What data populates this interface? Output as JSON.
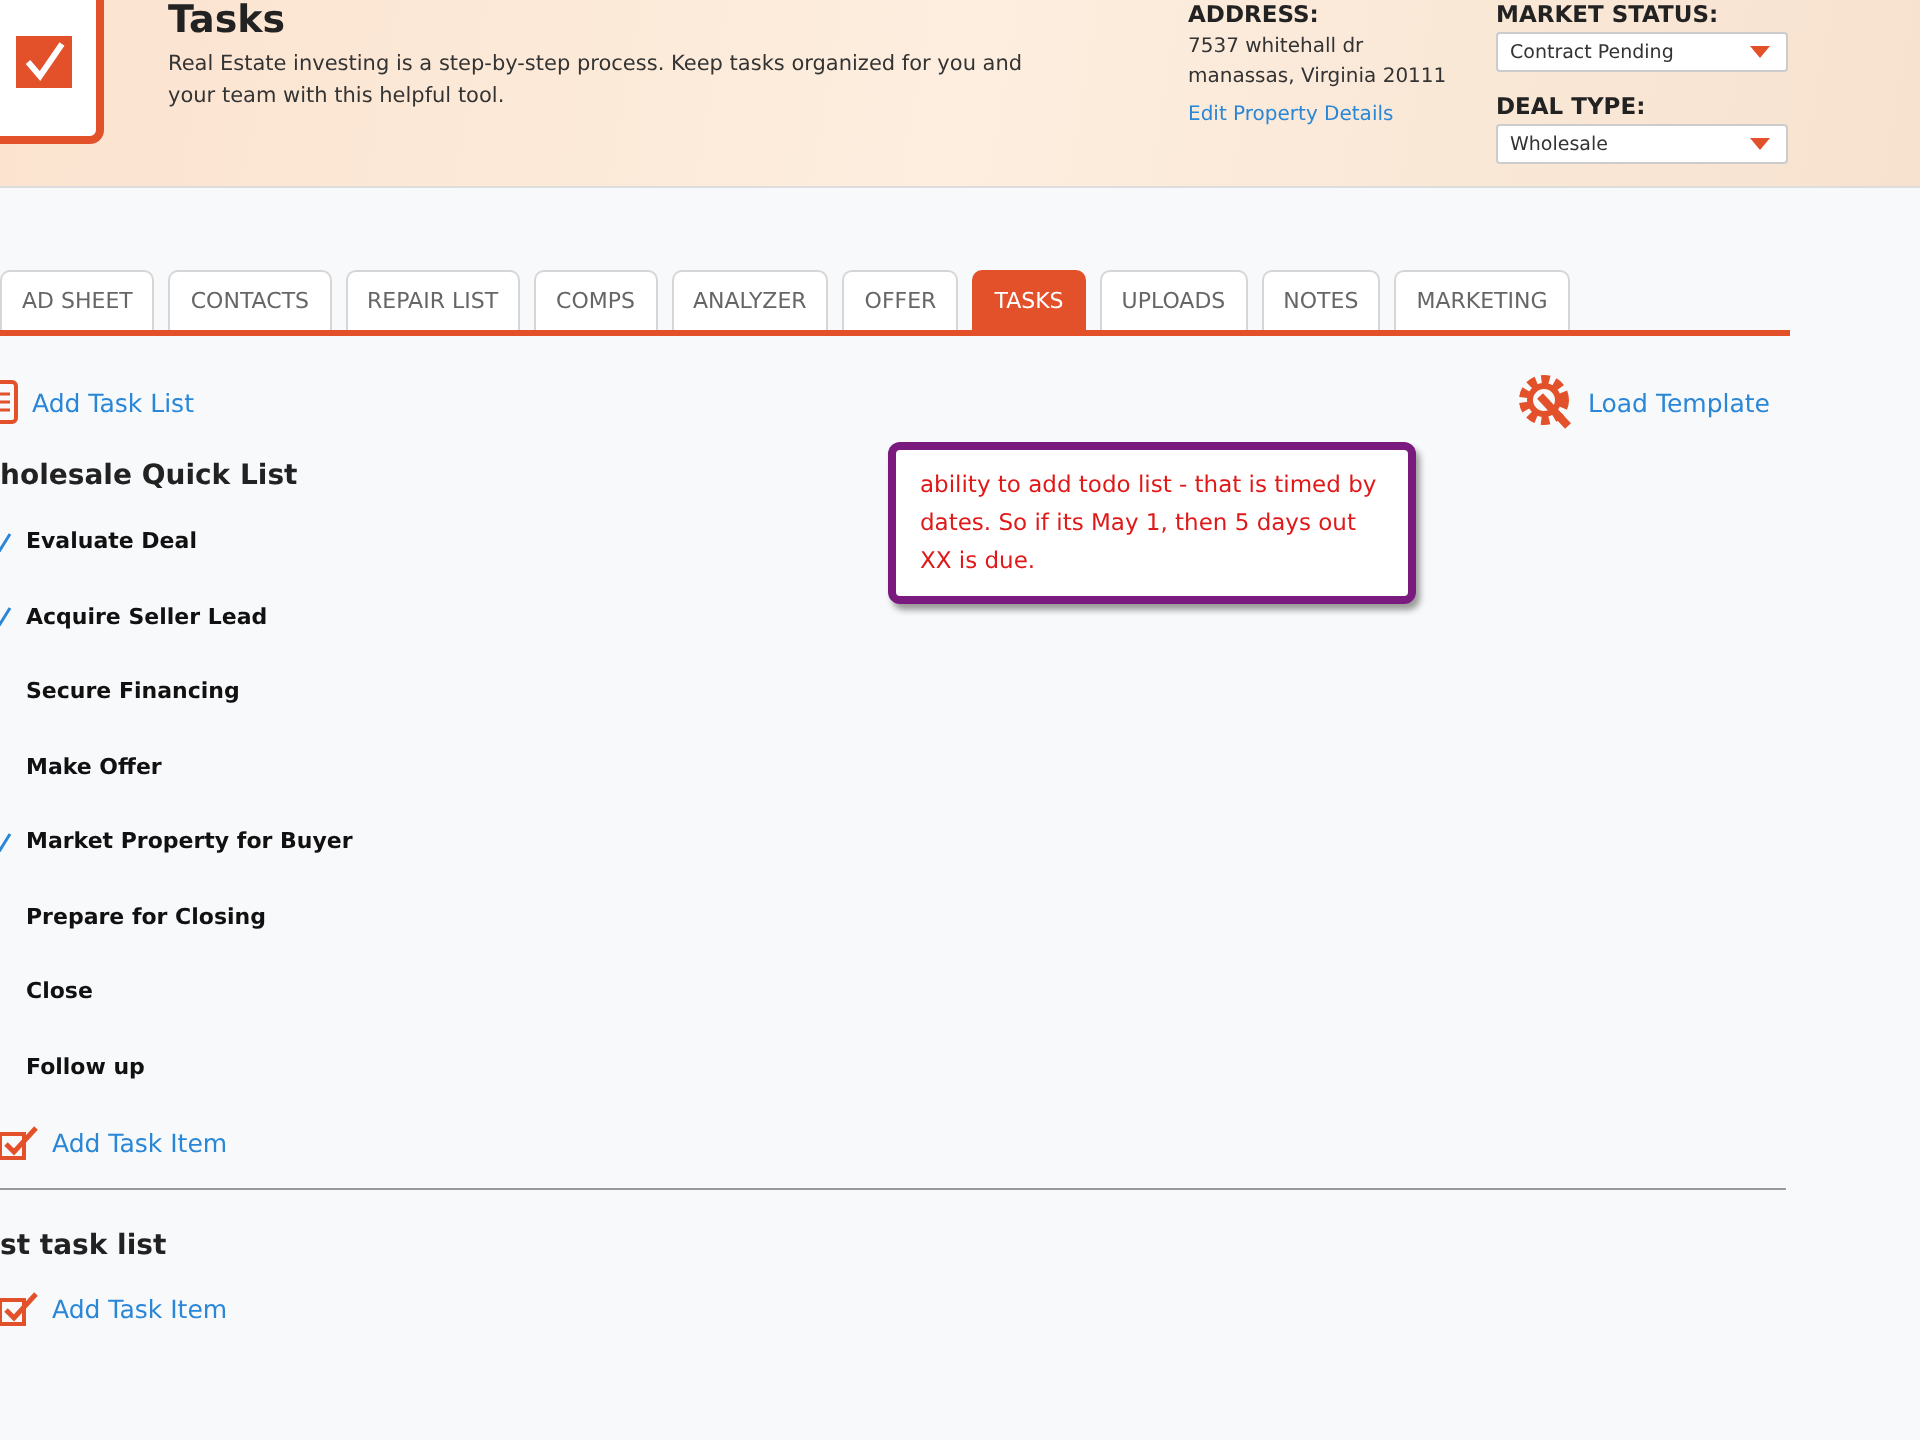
{
  "header": {
    "title": "Tasks",
    "description": "Real Estate investing is a step-by-step process. Keep tasks organized for you and your team with this helpful tool.",
    "address_label": "ADDRESS:",
    "address_lines": [
      "7537 whitehall dr",
      "manassas, Virginia 20111"
    ],
    "edit_link": "Edit Property Details",
    "market_status": {
      "label": "MARKET STATUS:",
      "value": "Contract Pending"
    },
    "deal_type": {
      "label": "DEAL TYPE:",
      "value": "Wholesale"
    }
  },
  "tabs": [
    {
      "label": "AD SHEET",
      "selected": false
    },
    {
      "label": "CONTACTS",
      "selected": false
    },
    {
      "label": "REPAIR LIST",
      "selected": false
    },
    {
      "label": "COMPS",
      "selected": false
    },
    {
      "label": "ANALYZER",
      "selected": false
    },
    {
      "label": "OFFER",
      "selected": false
    },
    {
      "label": "TASKS",
      "selected": true
    },
    {
      "label": "UPLOADS",
      "selected": false
    },
    {
      "label": "NOTES",
      "selected": false
    },
    {
      "label": "MARKETING",
      "selected": false
    }
  ],
  "add_task_list": "Add Task List",
  "load_template": "Load Template",
  "note": "ability to add todo list - that is timed by dates. So if its May 1, then 5 days out XX is due.",
  "task_lists": [
    {
      "title": "holesale Quick List",
      "add_item": "Add Task Item",
      "items": [
        {
          "label": "Evaluate Deal",
          "checked": true
        },
        {
          "label": "Acquire Seller Lead",
          "checked": true
        },
        {
          "label": "Secure Financing",
          "checked": false
        },
        {
          "label": "Make Offer",
          "checked": false
        },
        {
          "label": "Market Property for Buyer",
          "checked": true
        },
        {
          "label": "Prepare for Closing",
          "checked": false
        },
        {
          "label": "Close",
          "checked": false
        },
        {
          "label": "Follow up",
          "checked": false
        }
      ]
    },
    {
      "title": "st task list",
      "add_item": "Add Task Item"
    }
  ]
}
